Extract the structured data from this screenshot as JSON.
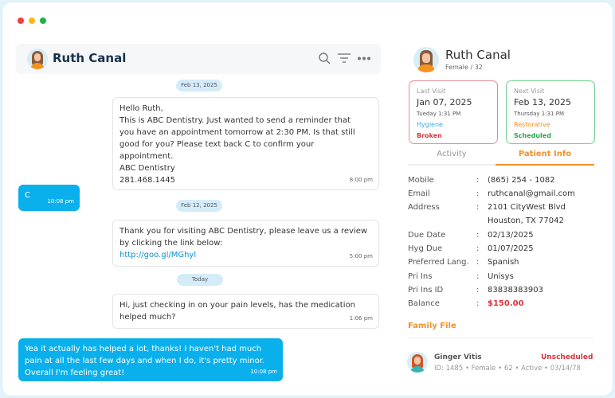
{
  "window": {
    "dot_colors": [
      "#ef4040",
      "#fbb612",
      "#1db446"
    ]
  },
  "chat": {
    "contact_name": "Ruth Canal",
    "icons": [
      "search-icon",
      "filter-icon",
      "more-icon"
    ],
    "messages": [
      {
        "type": "date",
        "text": "Feb 13, 2025"
      },
      {
        "type": "in",
        "lines": [
          "Hello Ruth,",
          "This is ABC Dentistry. Just wanted to send a reminder that",
          "you have an appointment tomorrow at 2:30 PM. Is that still",
          "good for you? Please text back C to confirm your",
          "appointment.",
          "ABC Dentistry",
          "281.468.1445"
        ],
        "time": "8:00 pm"
      },
      {
        "type": "out",
        "text": "C",
        "time": "10:08 pm"
      },
      {
        "type": "date",
        "text": "Feb 12, 2025"
      },
      {
        "type": "in",
        "lines": [
          "Thank you for visiting ABC Dentistry, please leave us a review",
          "by clicking the link below:"
        ],
        "link": "http://goo.gl/MGhyl",
        "time": "5:00 pm"
      },
      {
        "type": "date",
        "text": "Today"
      },
      {
        "type": "in",
        "lines": [
          "Hi, just checking in on your pain levels, has the medication",
          "helped much?"
        ],
        "time": "1:06 pm"
      },
      {
        "type": "out",
        "lines": [
          "Yea it actually has helped a lot, thanks! I haven't had much",
          "pain at all the last few days and when I do, it's pretty minor.",
          "Overall I'm feeling great!"
        ],
        "time": "10:08 pm"
      }
    ]
  },
  "patient": {
    "name": "Ruth Canal",
    "sub": "Female / 32",
    "last_visit": {
      "label": "Last Visit",
      "date": "Jan 07, 2025",
      "time": "Tueday 1:31 PM",
      "type": "Hygiene",
      "status": "Broken",
      "color": "#d9343f"
    },
    "next_visit": {
      "label": "Next Visit",
      "date": "Feb 13, 2025",
      "time": "Thursday 1:31 PM",
      "type": "Restorative",
      "status": "Scheduled",
      "color": "#27a74a"
    },
    "tabs": [
      {
        "label": "Activity",
        "active": false
      },
      {
        "label": "Patient Info",
        "active": true
      }
    ],
    "accent": "#f0922b",
    "info": [
      {
        "label": "Mobile",
        "value": "(865) 254 - 1082"
      },
      {
        "label": "Email",
        "value": "ruthcanal@gmail.com"
      },
      {
        "label": "Address",
        "value": "2101 CityWest Blvd",
        "value2": "Houston, TX 77042"
      },
      {
        "label": "Due Date",
        "value": "02/13/2025"
      },
      {
        "label": "Hyg Due",
        "value": "01/07/2025"
      },
      {
        "label": "Preferred Lang.",
        "value": "Spanish"
      },
      {
        "label": "Pri Ins",
        "value": "Unisys"
      },
      {
        "label": "Pri Ins ID",
        "value": "83838383903"
      },
      {
        "label": "Balance",
        "value": "$150.00"
      }
    ],
    "family_title": "Family File",
    "family": [
      {
        "name": "Ginger Vitis",
        "status": "Unscheduled",
        "details": "ID: 1485 • Female • 62 • Active • 03/14/78"
      }
    ]
  }
}
